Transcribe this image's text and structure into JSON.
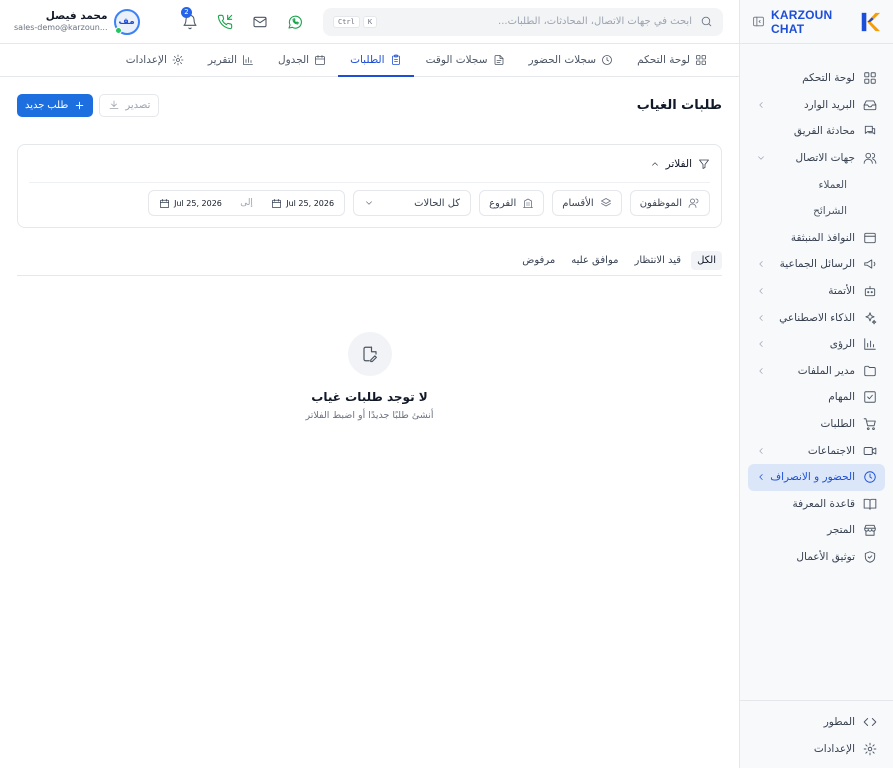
{
  "brand": {
    "name": "KARZOUN CHAT"
  },
  "search": {
    "placeholder": "ابحث في جهات الاتصال، المحادثات، الطلبات...",
    "shortcut_key": "K",
    "shortcut_mod": "Ctrl"
  },
  "notifications": {
    "count": "2"
  },
  "user": {
    "name": "محمد فيصل",
    "email": "sales-demo@karzoun...",
    "initials": "مف"
  },
  "sidebar": {
    "items": [
      {
        "label": "لوحة التحكم"
      },
      {
        "label": "البريد الوارد"
      },
      {
        "label": "محادثة الفريق"
      },
      {
        "label": "جهات الاتصال"
      },
      {
        "label": "العملاء"
      },
      {
        "label": "الشرائح"
      },
      {
        "label": "النوافذ المنبثقة"
      },
      {
        "label": "الرسائل الجماعية"
      },
      {
        "label": "الأتمتة"
      },
      {
        "label": "الذكاء الاصطناعي"
      },
      {
        "label": "الرؤى"
      },
      {
        "label": "مدير الملفات"
      },
      {
        "label": "المهام"
      },
      {
        "label": "الطلبات"
      },
      {
        "label": "الاجتماعات"
      },
      {
        "label": "الحضور و الانصراف"
      },
      {
        "label": "قاعدة المعرفة"
      },
      {
        "label": "المتجر"
      },
      {
        "label": "توثيق الأعمال"
      }
    ],
    "bottom": [
      {
        "label": "المطور"
      },
      {
        "label": "الإعدادات"
      }
    ]
  },
  "tabs": [
    {
      "label": "لوحة التحكم"
    },
    {
      "label": "سجلات الحضور"
    },
    {
      "label": "سجلات الوقت"
    },
    {
      "label": "الطلبات"
    },
    {
      "label": "الجدول"
    },
    {
      "label": "التقرير"
    },
    {
      "label": "الإعدادات"
    }
  ],
  "page": {
    "title": "طلبات الغياب",
    "export_label": "تصدير",
    "new_label": "طلب جديد"
  },
  "filters": {
    "title": "الفلاتر",
    "employees": "الموظفون",
    "departments": "الأقسام",
    "branches": "الفروع",
    "status_selected": "كل الحالات",
    "date_from": "Jul 25, 2026",
    "date_sep": "إلى",
    "date_to": "Jul 25, 2026"
  },
  "status_tabs": [
    {
      "label": "الكل"
    },
    {
      "label": "قيد الانتظار"
    },
    {
      "label": "موافق عليه"
    },
    {
      "label": "مرفوض"
    }
  ],
  "empty": {
    "title": "لا توجد طلبات غياب",
    "subtitle": "أنشئ طلبًا جديدًا أو اضبط الفلاتر"
  },
  "colors": {
    "accent": "#1d4ed8",
    "primary_button": "#1d6fe0",
    "active_nav_bg": "#dbe7f8",
    "online": "#22c55e",
    "whatsapp": "#16a34a"
  },
  "icons": {
    "sidebar": [
      "dashboard-icon",
      "inbox-icon",
      "team-chat-icon",
      "contacts-icon",
      "",
      "",
      "popup-icon",
      "megaphone-icon",
      "bot-icon",
      "sparkles-icon",
      "chart-icon",
      "folder-icon",
      "checkbox-icon",
      "cart-icon",
      "video-icon",
      "clock-icon",
      "book-icon",
      "store-icon",
      "shield-check-icon"
    ]
  }
}
